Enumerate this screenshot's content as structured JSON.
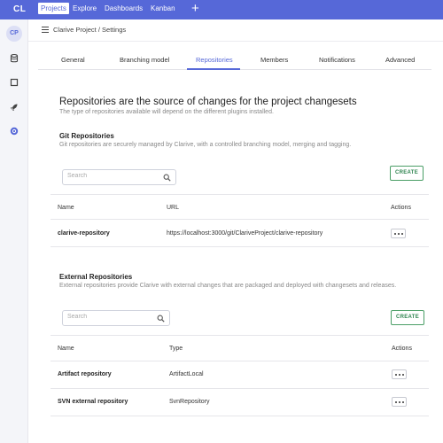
{
  "nav": {
    "logo": "CL",
    "items": [
      {
        "label": "Projects",
        "active": true
      },
      {
        "label": "Explore",
        "active": false
      },
      {
        "label": "Dashboards",
        "active": false
      },
      {
        "label": "Kanban",
        "active": false
      }
    ],
    "plus_icon": "plus-icon"
  },
  "sidebar": {
    "avatar": "CP",
    "icons": [
      "database-icon",
      "square-icon",
      "rocket-icon",
      "gear-icon"
    ]
  },
  "breadcrumb": {
    "text": "Clarive Project  /  Settings"
  },
  "tabs": [
    {
      "label": "General",
      "active": false
    },
    {
      "label": "Branching model",
      "active": false
    },
    {
      "label": "Repositories",
      "active": true
    },
    {
      "label": "Members",
      "active": false
    },
    {
      "label": "Notifications",
      "active": false
    },
    {
      "label": "Advanced",
      "active": false
    }
  ],
  "page": {
    "title": "Repositories are the source of changes for the project changesets",
    "subtitle": "The type of repositories available will depend on the different plugins installed."
  },
  "git": {
    "title": "Git Repositories",
    "description": "Git repositories are securely managed by Clarive, with a controlled branching model, merging and tagging.",
    "search_placeholder": "Search",
    "create_label": "CREATE",
    "columns": {
      "name": "Name",
      "url": "URL",
      "actions": "Actions"
    },
    "rows": [
      {
        "name": "clarive-repository",
        "url": "https://localhost:3000/git/ClariveProject/clarive-repository"
      }
    ]
  },
  "external": {
    "title": "External Repositories",
    "description": "External repositories provide Clarive with external changes that are packaged and deployed with changesets and releases.",
    "search_placeholder": "Search",
    "create_label": "CREATE",
    "columns": {
      "name": "Name",
      "type": "Type",
      "actions": "Actions"
    },
    "rows": [
      {
        "name": "Artifact repository",
        "type": "ArtifactLocal"
      },
      {
        "name": "SVN external repository",
        "type": "SvnRepository"
      }
    ]
  },
  "colors": {
    "brand": "#5668d8",
    "create_green": "#2f8550"
  }
}
